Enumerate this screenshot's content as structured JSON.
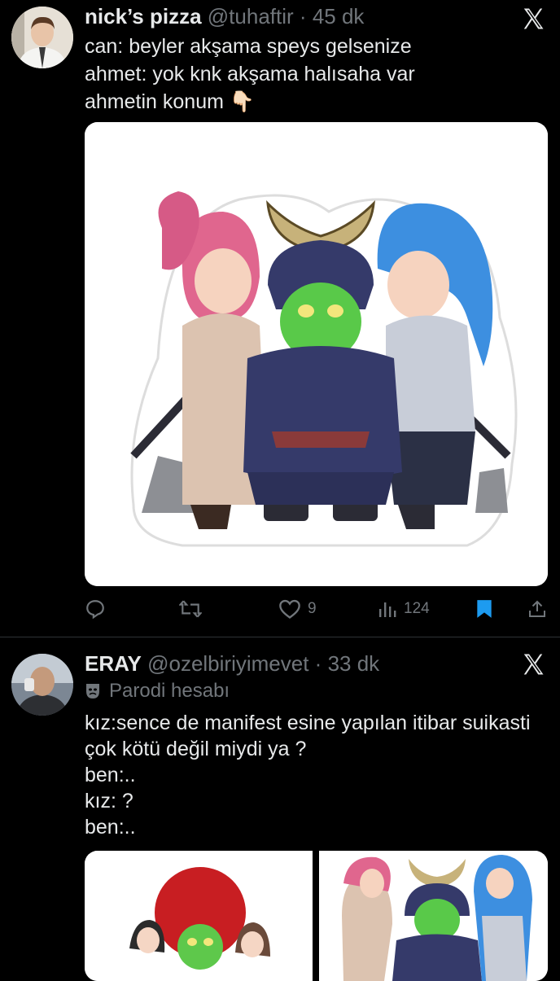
{
  "tweets": [
    {
      "name": "nick’s pizza",
      "handle": "@tuhaftir",
      "separator": "·",
      "time": "45 dk",
      "lines": [
        "can: beyler akşama speys gelsenize",
        "ahmet: yok knk akşama halısaha var",
        "ahmetin konum"
      ],
      "emoji": "👇🏻",
      "stats": {
        "likes": "9",
        "views": "124"
      }
    },
    {
      "name": "ERAY",
      "handle": "@ozelbiriyimevet",
      "separator": "·",
      "time": "33 dk",
      "label": "Parodi hesabı",
      "lines": [
        "kız:sence de manifest esine yapılan itibar suikasti",
        "çok kötü değil miydi ya ?",
        "ben:..",
        "kız: ?",
        "ben:.."
      ]
    }
  ],
  "icons": {
    "logo": "x-logo-icon",
    "reply": "reply-icon",
    "retweet": "retweet-icon",
    "like": "heart-icon",
    "views": "views-icon",
    "bookmark": "bookmark-icon",
    "share": "share-icon",
    "parody": "theater-masks-icon"
  },
  "colors": {
    "background": "#000000",
    "text": "#e7e9ea",
    "muted": "#71767b",
    "bookmark": "#1d9bf0"
  }
}
